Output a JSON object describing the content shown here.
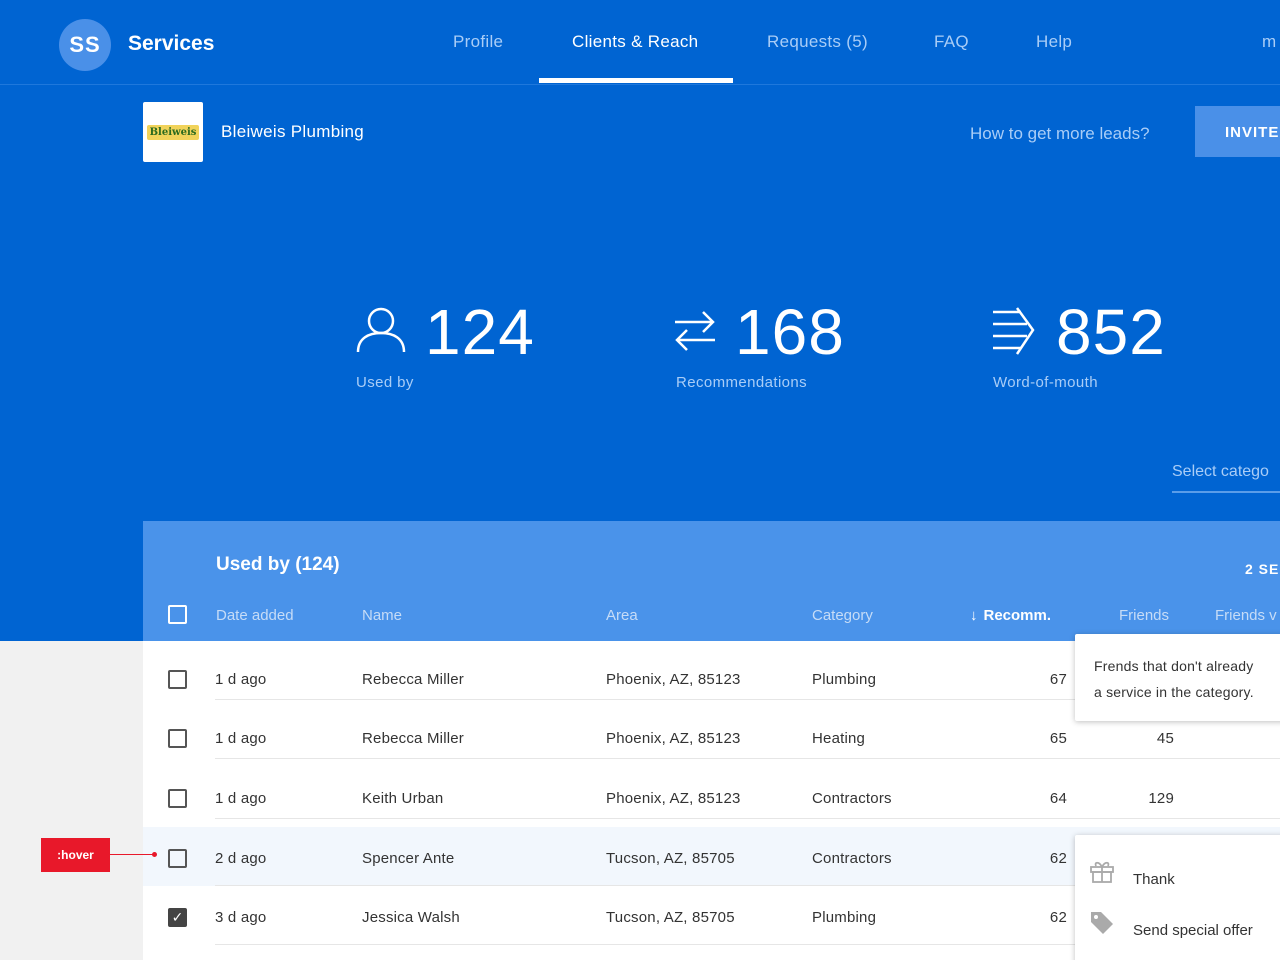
{
  "app": {
    "logo_initials": "SS",
    "brand": "Services"
  },
  "nav": {
    "items": [
      {
        "label": "Profile",
        "active": false
      },
      {
        "label": "Clients & Reach",
        "active": true
      },
      {
        "label": "Requests (5)",
        "active": false
      },
      {
        "label": "FAQ",
        "active": false
      },
      {
        "label": "Help",
        "active": false
      }
    ],
    "user_menu": "m"
  },
  "business": {
    "logo_text": "Bleiweis",
    "name": "Bleiweis Plumbing",
    "leads_link": "How to get more leads?",
    "invite_label": "INVITE"
  },
  "stats": [
    {
      "icon": "user-icon",
      "value": "124",
      "label": "Used by"
    },
    {
      "icon": "swap-arrows-icon",
      "value": "168",
      "label": "Recommendations"
    },
    {
      "icon": "spread-arrows-icon",
      "value": "852",
      "label": "Word-of-mouth"
    }
  ],
  "filter": {
    "select_category": "Select catego"
  },
  "table": {
    "title": "Used by (124)",
    "selected_label": "2 SE",
    "columns": [
      {
        "label": "Date added",
        "sorted": false
      },
      {
        "label": "Name",
        "sorted": false
      },
      {
        "label": "Area",
        "sorted": false
      },
      {
        "label": "Category",
        "sorted": false
      },
      {
        "label": "Recomm.",
        "sorted": true,
        "sort_arrow": "↓"
      },
      {
        "label": "Friends",
        "sorted": false
      },
      {
        "label": "Friends v",
        "sorted": false
      }
    ],
    "rows": [
      {
        "date": "1 d ago",
        "name": "Rebecca Miller",
        "area": "Phoenix, AZ, 85123",
        "category": "Plumbing",
        "recomm": "67",
        "friends": "",
        "checked": false,
        "hover": false
      },
      {
        "date": "1 d ago",
        "name": "Rebecca Miller",
        "area": "Phoenix, AZ, 85123",
        "category": "Heating",
        "recomm": "65",
        "friends": "45",
        "checked": false,
        "hover": false
      },
      {
        "date": "1 d ago",
        "name": "Keith Urban",
        "area": "Phoenix, AZ, 85123",
        "category": "Contractors",
        "recomm": "64",
        "friends": "129",
        "checked": false,
        "hover": false
      },
      {
        "date": "2 d ago",
        "name": "Spencer Ante",
        "area": "Tucson, AZ, 85705",
        "category": "Contractors",
        "recomm": "62",
        "friends": "",
        "checked": false,
        "hover": true
      },
      {
        "date": "3 d ago",
        "name": "Jessica Walsh",
        "area": "Tucson, AZ, 85705",
        "category": "Plumbing",
        "recomm": "62",
        "friends": "",
        "checked": true,
        "hover": false
      }
    ]
  },
  "tooltip": {
    "line1": "Frends that don't already",
    "line2": "a service in the category."
  },
  "row_menu": {
    "items": [
      {
        "icon": "gift-icon",
        "label": "Thank"
      },
      {
        "icon": "tag-icon",
        "label": "Send special offer"
      }
    ]
  },
  "annotation": {
    "hover_tag": ":hover"
  },
  "colors": {
    "hero_bg": "#0064d2",
    "card_header": "#4a93ea",
    "accent": "#4a90e8",
    "annotation_red": "#e8182a"
  }
}
